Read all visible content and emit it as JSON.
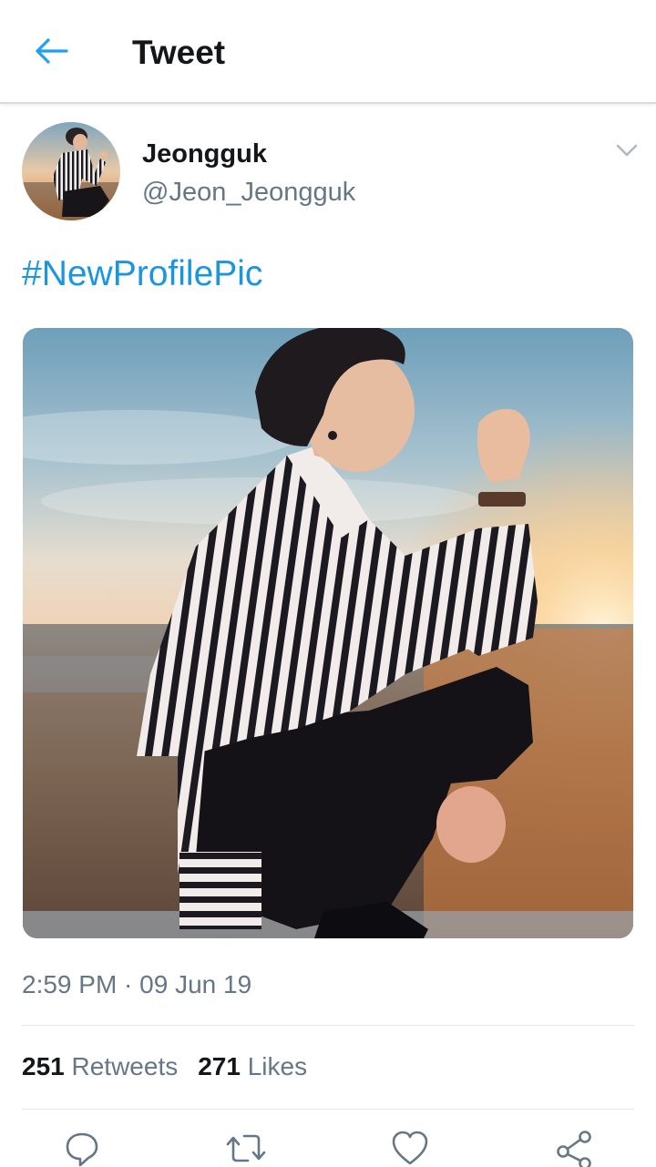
{
  "header": {
    "title": "Tweet",
    "back_icon": "arrow-left-icon",
    "accent": "#1da1f2"
  },
  "author": {
    "name": "Jeongguk",
    "handle": "@Jeon_Jeongguk"
  },
  "tweet": {
    "text": "#NewProfilePic",
    "link_color": "#1b95e0",
    "timestamp": "2:59 PM · 09 Jun 19"
  },
  "stats": {
    "retweets_count": "251",
    "retweets_label": "Retweets",
    "likes_count": "271",
    "likes_label": "Likes"
  },
  "actions": [
    {
      "icon": "reply-icon"
    },
    {
      "icon": "retweet-icon"
    },
    {
      "icon": "heart-icon"
    },
    {
      "icon": "share-icon"
    }
  ],
  "colors": {
    "primary_text": "#14171a",
    "secondary_text": "#657786",
    "divider": "#e1e8ed"
  }
}
